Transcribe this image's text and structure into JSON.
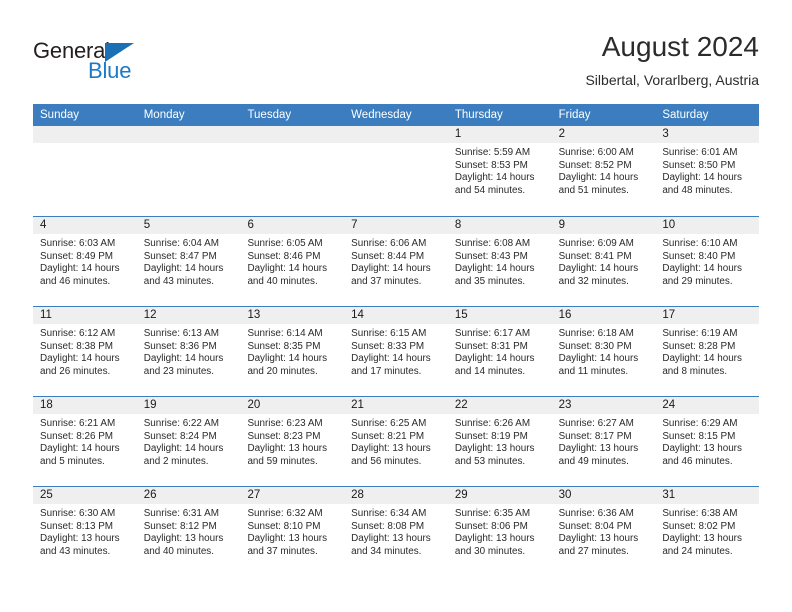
{
  "brand": {
    "line1": "General",
    "line2": "Blue",
    "triangle_color": "#1b6fb5",
    "line2_color": "#1b7ac7"
  },
  "header": {
    "title": "August 2024",
    "subtitle": "Silbertal, Vorarlberg, Austria"
  },
  "theme": {
    "header_bg": "#3b7dbf",
    "header_text": "#ffffff",
    "day_band_bg": "#efefef",
    "grid_line": "#3b7dbf"
  },
  "weekdays": [
    "Sunday",
    "Monday",
    "Tuesday",
    "Wednesday",
    "Thursday",
    "Friday",
    "Saturday"
  ],
  "labels": {
    "sunrise_prefix": "Sunrise: ",
    "sunset_prefix": "Sunset: ",
    "daylight_prefix": "Daylight: "
  },
  "weeks": [
    [
      {
        "day": "",
        "empty": true
      },
      {
        "day": "",
        "empty": true
      },
      {
        "day": "",
        "empty": true
      },
      {
        "day": "",
        "empty": true
      },
      {
        "day": "1",
        "sunrise": "Sunrise: 5:59 AM",
        "sunset": "Sunset: 8:53 PM",
        "daylight": "Daylight: 14 hours and 54 minutes."
      },
      {
        "day": "2",
        "sunrise": "Sunrise: 6:00 AM",
        "sunset": "Sunset: 8:52 PM",
        "daylight": "Daylight: 14 hours and 51 minutes."
      },
      {
        "day": "3",
        "sunrise": "Sunrise: 6:01 AM",
        "sunset": "Sunset: 8:50 PM",
        "daylight": "Daylight: 14 hours and 48 minutes."
      }
    ],
    [
      {
        "day": "4",
        "sunrise": "Sunrise: 6:03 AM",
        "sunset": "Sunset: 8:49 PM",
        "daylight": "Daylight: 14 hours and 46 minutes."
      },
      {
        "day": "5",
        "sunrise": "Sunrise: 6:04 AM",
        "sunset": "Sunset: 8:47 PM",
        "daylight": "Daylight: 14 hours and 43 minutes."
      },
      {
        "day": "6",
        "sunrise": "Sunrise: 6:05 AM",
        "sunset": "Sunset: 8:46 PM",
        "daylight": "Daylight: 14 hours and 40 minutes."
      },
      {
        "day": "7",
        "sunrise": "Sunrise: 6:06 AM",
        "sunset": "Sunset: 8:44 PM",
        "daylight": "Daylight: 14 hours and 37 minutes."
      },
      {
        "day": "8",
        "sunrise": "Sunrise: 6:08 AM",
        "sunset": "Sunset: 8:43 PM",
        "daylight": "Daylight: 14 hours and 35 minutes."
      },
      {
        "day": "9",
        "sunrise": "Sunrise: 6:09 AM",
        "sunset": "Sunset: 8:41 PM",
        "daylight": "Daylight: 14 hours and 32 minutes."
      },
      {
        "day": "10",
        "sunrise": "Sunrise: 6:10 AM",
        "sunset": "Sunset: 8:40 PM",
        "daylight": "Daylight: 14 hours and 29 minutes."
      }
    ],
    [
      {
        "day": "11",
        "sunrise": "Sunrise: 6:12 AM",
        "sunset": "Sunset: 8:38 PM",
        "daylight": "Daylight: 14 hours and 26 minutes."
      },
      {
        "day": "12",
        "sunrise": "Sunrise: 6:13 AM",
        "sunset": "Sunset: 8:36 PM",
        "daylight": "Daylight: 14 hours and 23 minutes."
      },
      {
        "day": "13",
        "sunrise": "Sunrise: 6:14 AM",
        "sunset": "Sunset: 8:35 PM",
        "daylight": "Daylight: 14 hours and 20 minutes."
      },
      {
        "day": "14",
        "sunrise": "Sunrise: 6:15 AM",
        "sunset": "Sunset: 8:33 PM",
        "daylight": "Daylight: 14 hours and 17 minutes."
      },
      {
        "day": "15",
        "sunrise": "Sunrise: 6:17 AM",
        "sunset": "Sunset: 8:31 PM",
        "daylight": "Daylight: 14 hours and 14 minutes."
      },
      {
        "day": "16",
        "sunrise": "Sunrise: 6:18 AM",
        "sunset": "Sunset: 8:30 PM",
        "daylight": "Daylight: 14 hours and 11 minutes."
      },
      {
        "day": "17",
        "sunrise": "Sunrise: 6:19 AM",
        "sunset": "Sunset: 8:28 PM",
        "daylight": "Daylight: 14 hours and 8 minutes."
      }
    ],
    [
      {
        "day": "18",
        "sunrise": "Sunrise: 6:21 AM",
        "sunset": "Sunset: 8:26 PM",
        "daylight": "Daylight: 14 hours and 5 minutes."
      },
      {
        "day": "19",
        "sunrise": "Sunrise: 6:22 AM",
        "sunset": "Sunset: 8:24 PM",
        "daylight": "Daylight: 14 hours and 2 minutes."
      },
      {
        "day": "20",
        "sunrise": "Sunrise: 6:23 AM",
        "sunset": "Sunset: 8:23 PM",
        "daylight": "Daylight: 13 hours and 59 minutes."
      },
      {
        "day": "21",
        "sunrise": "Sunrise: 6:25 AM",
        "sunset": "Sunset: 8:21 PM",
        "daylight": "Daylight: 13 hours and 56 minutes."
      },
      {
        "day": "22",
        "sunrise": "Sunrise: 6:26 AM",
        "sunset": "Sunset: 8:19 PM",
        "daylight": "Daylight: 13 hours and 53 minutes."
      },
      {
        "day": "23",
        "sunrise": "Sunrise: 6:27 AM",
        "sunset": "Sunset: 8:17 PM",
        "daylight": "Daylight: 13 hours and 49 minutes."
      },
      {
        "day": "24",
        "sunrise": "Sunrise: 6:29 AM",
        "sunset": "Sunset: 8:15 PM",
        "daylight": "Daylight: 13 hours and 46 minutes."
      }
    ],
    [
      {
        "day": "25",
        "sunrise": "Sunrise: 6:30 AM",
        "sunset": "Sunset: 8:13 PM",
        "daylight": "Daylight: 13 hours and 43 minutes."
      },
      {
        "day": "26",
        "sunrise": "Sunrise: 6:31 AM",
        "sunset": "Sunset: 8:12 PM",
        "daylight": "Daylight: 13 hours and 40 minutes."
      },
      {
        "day": "27",
        "sunrise": "Sunrise: 6:32 AM",
        "sunset": "Sunset: 8:10 PM",
        "daylight": "Daylight: 13 hours and 37 minutes."
      },
      {
        "day": "28",
        "sunrise": "Sunrise: 6:34 AM",
        "sunset": "Sunset: 8:08 PM",
        "daylight": "Daylight: 13 hours and 34 minutes."
      },
      {
        "day": "29",
        "sunrise": "Sunrise: 6:35 AM",
        "sunset": "Sunset: 8:06 PM",
        "daylight": "Daylight: 13 hours and 30 minutes."
      },
      {
        "day": "30",
        "sunrise": "Sunrise: 6:36 AM",
        "sunset": "Sunset: 8:04 PM",
        "daylight": "Daylight: 13 hours and 27 minutes."
      },
      {
        "day": "31",
        "sunrise": "Sunrise: 6:38 AM",
        "sunset": "Sunset: 8:02 PM",
        "daylight": "Daylight: 13 hours and 24 minutes."
      }
    ]
  ]
}
